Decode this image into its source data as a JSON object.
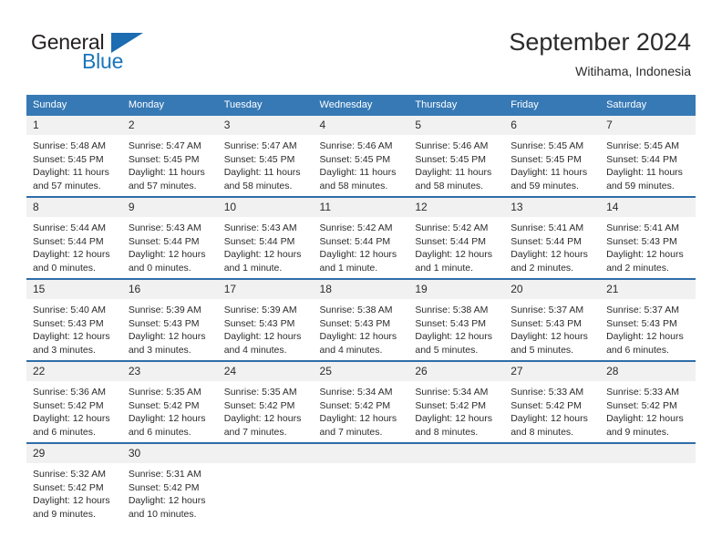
{
  "brand": {
    "name_top": "General",
    "name_bottom": "Blue",
    "accent_color": "#1b6cb0"
  },
  "header": {
    "title": "September 2024",
    "subtitle": "Witihama, Indonesia"
  },
  "theme": {
    "header_row_bg": "#3679b5",
    "row_divider": "#2f6da8",
    "daynum_bg": "#f1f1f1",
    "text": "#2b2b2b"
  },
  "labels": {
    "sunrise_prefix": "Sunrise:",
    "sunset_prefix": "Sunset:",
    "daylight_prefix": "Daylight:"
  },
  "weekdays": [
    "Sunday",
    "Monday",
    "Tuesday",
    "Wednesday",
    "Thursday",
    "Friday",
    "Saturday"
  ],
  "weeks": [
    [
      {
        "day": "1",
        "sunrise": "Sunrise: 5:48 AM",
        "sunset": "Sunset: 5:45 PM",
        "daylight": "Daylight: 11 hours and 57 minutes."
      },
      {
        "day": "2",
        "sunrise": "Sunrise: 5:47 AM",
        "sunset": "Sunset: 5:45 PM",
        "daylight": "Daylight: 11 hours and 57 minutes."
      },
      {
        "day": "3",
        "sunrise": "Sunrise: 5:47 AM",
        "sunset": "Sunset: 5:45 PM",
        "daylight": "Daylight: 11 hours and 58 minutes."
      },
      {
        "day": "4",
        "sunrise": "Sunrise: 5:46 AM",
        "sunset": "Sunset: 5:45 PM",
        "daylight": "Daylight: 11 hours and 58 minutes."
      },
      {
        "day": "5",
        "sunrise": "Sunrise: 5:46 AM",
        "sunset": "Sunset: 5:45 PM",
        "daylight": "Daylight: 11 hours and 58 minutes."
      },
      {
        "day": "6",
        "sunrise": "Sunrise: 5:45 AM",
        "sunset": "Sunset: 5:45 PM",
        "daylight": "Daylight: 11 hours and 59 minutes."
      },
      {
        "day": "7",
        "sunrise": "Sunrise: 5:45 AM",
        "sunset": "Sunset: 5:44 PM",
        "daylight": "Daylight: 11 hours and 59 minutes."
      }
    ],
    [
      {
        "day": "8",
        "sunrise": "Sunrise: 5:44 AM",
        "sunset": "Sunset: 5:44 PM",
        "daylight": "Daylight: 12 hours and 0 minutes."
      },
      {
        "day": "9",
        "sunrise": "Sunrise: 5:43 AM",
        "sunset": "Sunset: 5:44 PM",
        "daylight": "Daylight: 12 hours and 0 minutes."
      },
      {
        "day": "10",
        "sunrise": "Sunrise: 5:43 AM",
        "sunset": "Sunset: 5:44 PM",
        "daylight": "Daylight: 12 hours and 1 minute."
      },
      {
        "day": "11",
        "sunrise": "Sunrise: 5:42 AM",
        "sunset": "Sunset: 5:44 PM",
        "daylight": "Daylight: 12 hours and 1 minute."
      },
      {
        "day": "12",
        "sunrise": "Sunrise: 5:42 AM",
        "sunset": "Sunset: 5:44 PM",
        "daylight": "Daylight: 12 hours and 1 minute."
      },
      {
        "day": "13",
        "sunrise": "Sunrise: 5:41 AM",
        "sunset": "Sunset: 5:44 PM",
        "daylight": "Daylight: 12 hours and 2 minutes."
      },
      {
        "day": "14",
        "sunrise": "Sunrise: 5:41 AM",
        "sunset": "Sunset: 5:43 PM",
        "daylight": "Daylight: 12 hours and 2 minutes."
      }
    ],
    [
      {
        "day": "15",
        "sunrise": "Sunrise: 5:40 AM",
        "sunset": "Sunset: 5:43 PM",
        "daylight": "Daylight: 12 hours and 3 minutes."
      },
      {
        "day": "16",
        "sunrise": "Sunrise: 5:39 AM",
        "sunset": "Sunset: 5:43 PM",
        "daylight": "Daylight: 12 hours and 3 minutes."
      },
      {
        "day": "17",
        "sunrise": "Sunrise: 5:39 AM",
        "sunset": "Sunset: 5:43 PM",
        "daylight": "Daylight: 12 hours and 4 minutes."
      },
      {
        "day": "18",
        "sunrise": "Sunrise: 5:38 AM",
        "sunset": "Sunset: 5:43 PM",
        "daylight": "Daylight: 12 hours and 4 minutes."
      },
      {
        "day": "19",
        "sunrise": "Sunrise: 5:38 AM",
        "sunset": "Sunset: 5:43 PM",
        "daylight": "Daylight: 12 hours and 5 minutes."
      },
      {
        "day": "20",
        "sunrise": "Sunrise: 5:37 AM",
        "sunset": "Sunset: 5:43 PM",
        "daylight": "Daylight: 12 hours and 5 minutes."
      },
      {
        "day": "21",
        "sunrise": "Sunrise: 5:37 AM",
        "sunset": "Sunset: 5:43 PM",
        "daylight": "Daylight: 12 hours and 6 minutes."
      }
    ],
    [
      {
        "day": "22",
        "sunrise": "Sunrise: 5:36 AM",
        "sunset": "Sunset: 5:42 PM",
        "daylight": "Daylight: 12 hours and 6 minutes."
      },
      {
        "day": "23",
        "sunrise": "Sunrise: 5:35 AM",
        "sunset": "Sunset: 5:42 PM",
        "daylight": "Daylight: 12 hours and 6 minutes."
      },
      {
        "day": "24",
        "sunrise": "Sunrise: 5:35 AM",
        "sunset": "Sunset: 5:42 PM",
        "daylight": "Daylight: 12 hours and 7 minutes."
      },
      {
        "day": "25",
        "sunrise": "Sunrise: 5:34 AM",
        "sunset": "Sunset: 5:42 PM",
        "daylight": "Daylight: 12 hours and 7 minutes."
      },
      {
        "day": "26",
        "sunrise": "Sunrise: 5:34 AM",
        "sunset": "Sunset: 5:42 PM",
        "daylight": "Daylight: 12 hours and 8 minutes."
      },
      {
        "day": "27",
        "sunrise": "Sunrise: 5:33 AM",
        "sunset": "Sunset: 5:42 PM",
        "daylight": "Daylight: 12 hours and 8 minutes."
      },
      {
        "day": "28",
        "sunrise": "Sunrise: 5:33 AM",
        "sunset": "Sunset: 5:42 PM",
        "daylight": "Daylight: 12 hours and 9 minutes."
      }
    ],
    [
      {
        "day": "29",
        "sunrise": "Sunrise: 5:32 AM",
        "sunset": "Sunset: 5:42 PM",
        "daylight": "Daylight: 12 hours and 9 minutes."
      },
      {
        "day": "30",
        "sunrise": "Sunrise: 5:31 AM",
        "sunset": "Sunset: 5:42 PM",
        "daylight": "Daylight: 12 hours and 10 minutes."
      },
      {
        "day": "",
        "sunrise": "",
        "sunset": "",
        "daylight": ""
      },
      {
        "day": "",
        "sunrise": "",
        "sunset": "",
        "daylight": ""
      },
      {
        "day": "",
        "sunrise": "",
        "sunset": "",
        "daylight": ""
      },
      {
        "day": "",
        "sunrise": "",
        "sunset": "",
        "daylight": ""
      },
      {
        "day": "",
        "sunrise": "",
        "sunset": "",
        "daylight": ""
      }
    ]
  ]
}
